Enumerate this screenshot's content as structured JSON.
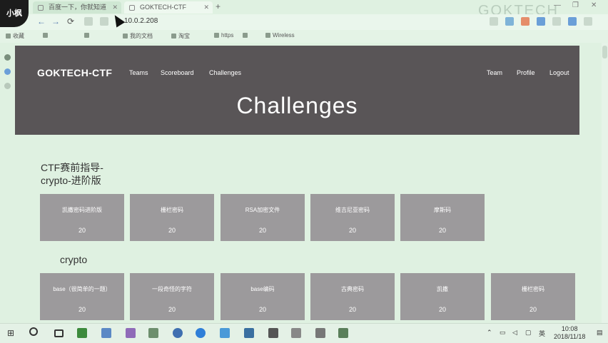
{
  "browser": {
    "avatar_text": "小枫",
    "tabs": [
      {
        "label": "百度一下，你就知道"
      },
      {
        "label": "GOKTECH-CTF"
      }
    ],
    "new_tab": "+",
    "watermark": "GOKTECH",
    "address": "10.0.2.208",
    "address_hint": "  ",
    "win_controls": [
      "—",
      "❐",
      "✕"
    ],
    "nav": {
      "back": "←",
      "forward": "→",
      "reload": "⟳"
    },
    "bookmarks": [
      "收藏",
      "",
      "",
      "我的文档",
      "淘宝",
      "https",
      "",
      "Wireless"
    ]
  },
  "site": {
    "brand": "GOKTECH-CTF",
    "nav_left": [
      "Teams",
      "Scoreboard",
      "Challenges"
    ],
    "nav_right": [
      "Team",
      "Profile",
      "Logout"
    ],
    "title": "Challenges"
  },
  "categories": [
    {
      "name": "CTF赛前指导-crypto-进阶版",
      "line1": "CTF赛前指导-",
      "line2": "crypto-进阶版",
      "cards": [
        {
          "name": "凯撒密码进阶版",
          "value": "20"
        },
        {
          "name": "栅栏密码",
          "value": "20"
        },
        {
          "name": "RSA加密文件",
          "value": "20"
        },
        {
          "name": "维吉尼亚密码",
          "value": "20"
        },
        {
          "name": "摩斯码",
          "value": "20"
        }
      ]
    },
    {
      "name": "crypto",
      "line1": "crypto",
      "line2": "",
      "cards": [
        {
          "name": "base（很简单的一题）",
          "value": "20"
        },
        {
          "name": "一段奇怪的字符",
          "value": "20"
        },
        {
          "name": "base编码",
          "value": "20"
        },
        {
          "name": "古典密码",
          "value": "20"
        },
        {
          "name": "凯撒",
          "value": "20"
        },
        {
          "name": "栅栏密码",
          "value": "20"
        }
      ]
    }
  ],
  "taskbar": {
    "start": "⊞",
    "input_method": "英",
    "time": "10:08",
    "date": "2018/11/18"
  },
  "colors": {
    "jumbotron": "#595557",
    "card": "#9c9a9c",
    "page_bg": "#dff1e1"
  }
}
